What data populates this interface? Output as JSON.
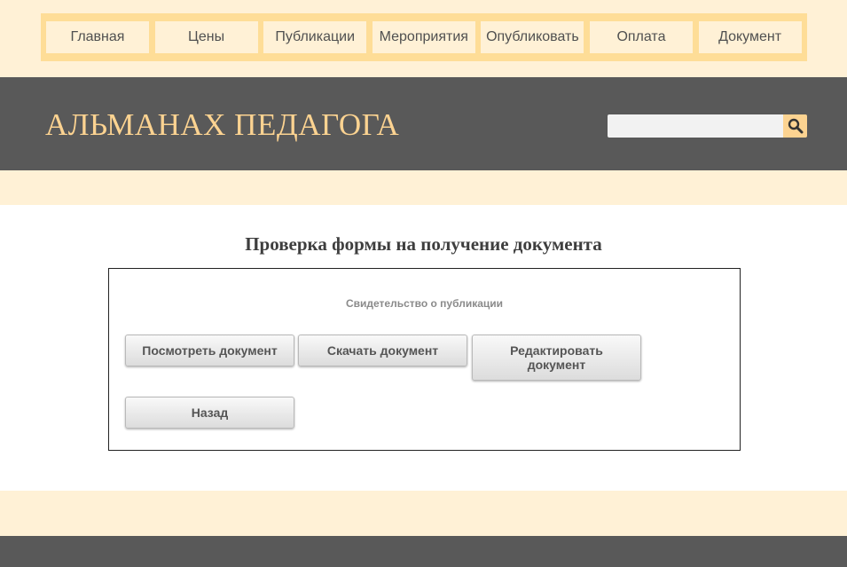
{
  "nav": {
    "items": [
      "Главная",
      "Цены",
      "Публикации",
      "Мероприятия",
      "Опубликовать",
      "Оплата",
      "Документ"
    ]
  },
  "header": {
    "brand": "АЛЬМАНАХ ПЕДАГОГА",
    "search": {
      "value": "",
      "placeholder": ""
    },
    "search_icon": "search-icon"
  },
  "main": {
    "title": "Проверка формы на получение документа",
    "panel": {
      "label": "Свидетельство о публикации",
      "buttons": {
        "view": "Посмотреть документ",
        "download": "Скачать документ",
        "edit": "Редактировать документ",
        "back": "Назад"
      }
    }
  },
  "colors": {
    "band": "#fff1d6",
    "nav_frame": "#fedd97",
    "header_bg": "#595959",
    "brand_text": "#fcd391",
    "accent": "#fcd391"
  }
}
